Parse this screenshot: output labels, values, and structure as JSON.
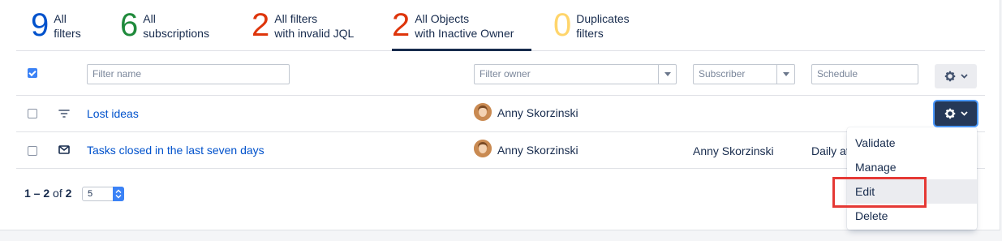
{
  "stats": [
    {
      "value": "9",
      "line1": "All",
      "line2": "filters",
      "color": "#0052cc"
    },
    {
      "value": "6",
      "line1": "All",
      "line2": "subscriptions",
      "color": "#1f8a3b"
    },
    {
      "value": "2",
      "line1": "All filters",
      "line2": "with invalid JQL",
      "color": "#de350b"
    },
    {
      "value": "2",
      "line1": "All Objects",
      "line2": "with Inactive Owner",
      "color": "#de350b"
    },
    {
      "value": "0",
      "line1": "Duplicates",
      "line2": "filters",
      "color": "#ffd56b"
    }
  ],
  "header": {
    "filter_name_placeholder": "Filter name",
    "filter_owner_placeholder": "Filter owner",
    "subscriber_placeholder": "Subscriber",
    "schedule_placeholder": "Schedule"
  },
  "rows": [
    {
      "icon": "filter-icon",
      "name": "Lost ideas",
      "owner": "Anny Skorzinski",
      "subscriber": "",
      "schedule": ""
    },
    {
      "icon": "mail-icon",
      "name": "Tasks closed in the last seven days",
      "owner": "Anny Skorzinski",
      "subscriber": "Anny Skorzinski",
      "schedule": "Daily at"
    }
  ],
  "pager": {
    "range": "1 – 2",
    "of": "of",
    "total": "2",
    "page_size": "5"
  },
  "menu": {
    "items": [
      "Validate",
      "Manage",
      "Edit",
      "Delete"
    ],
    "highlighted": "Edit"
  },
  "colors": {
    "accent": "#0052cc",
    "highlight_box": "#e53935",
    "dark_button": "#253858"
  }
}
